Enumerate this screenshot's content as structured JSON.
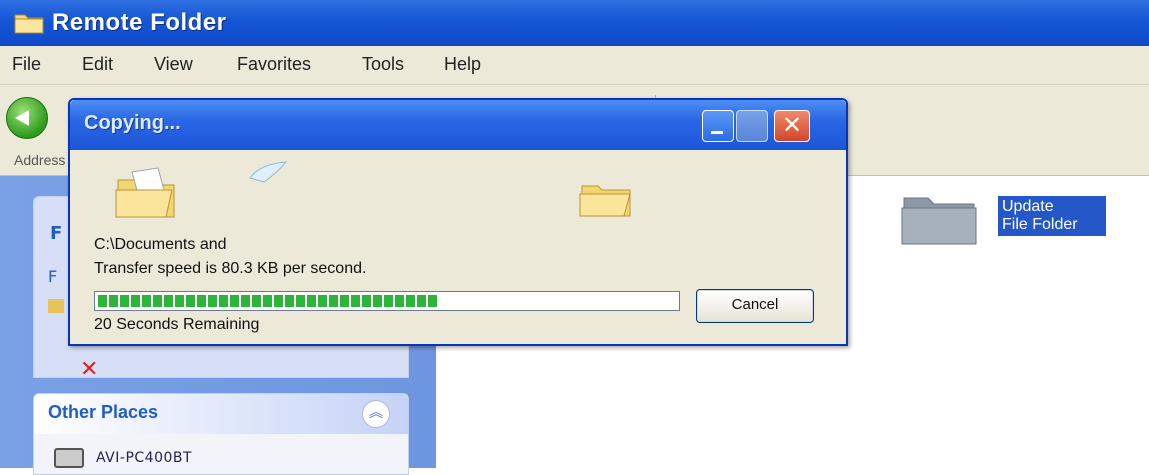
{
  "window": {
    "title": "Remote Folder",
    "icon": "folder-icon"
  },
  "menu": {
    "items": [
      "File",
      "Edit",
      "View",
      "Favorites",
      "Tools",
      "Help"
    ]
  },
  "address": {
    "label": "Address"
  },
  "taskpane": {
    "box1": {
      "header": "F",
      "row1": "F",
      "row2_text": ""
    },
    "other_places": {
      "header": "Other Places",
      "items": [
        "AVI-PC400BT"
      ]
    }
  },
  "content": {
    "folder_label_line1": "Update",
    "folder_label_line2": "File Folder"
  },
  "dialog": {
    "title": "Copying...",
    "filename": "C:\\Documents and",
    "speed": "Transfer speed is 80.3 KB per second.",
    "remaining": "20 Seconds Remaining",
    "cancel_label": "Cancel",
    "progress_fraction": 0.59
  },
  "colors": {
    "title_blue": "#1556d6",
    "progress_green": "#2fb43a",
    "close_red": "#d4452a"
  }
}
